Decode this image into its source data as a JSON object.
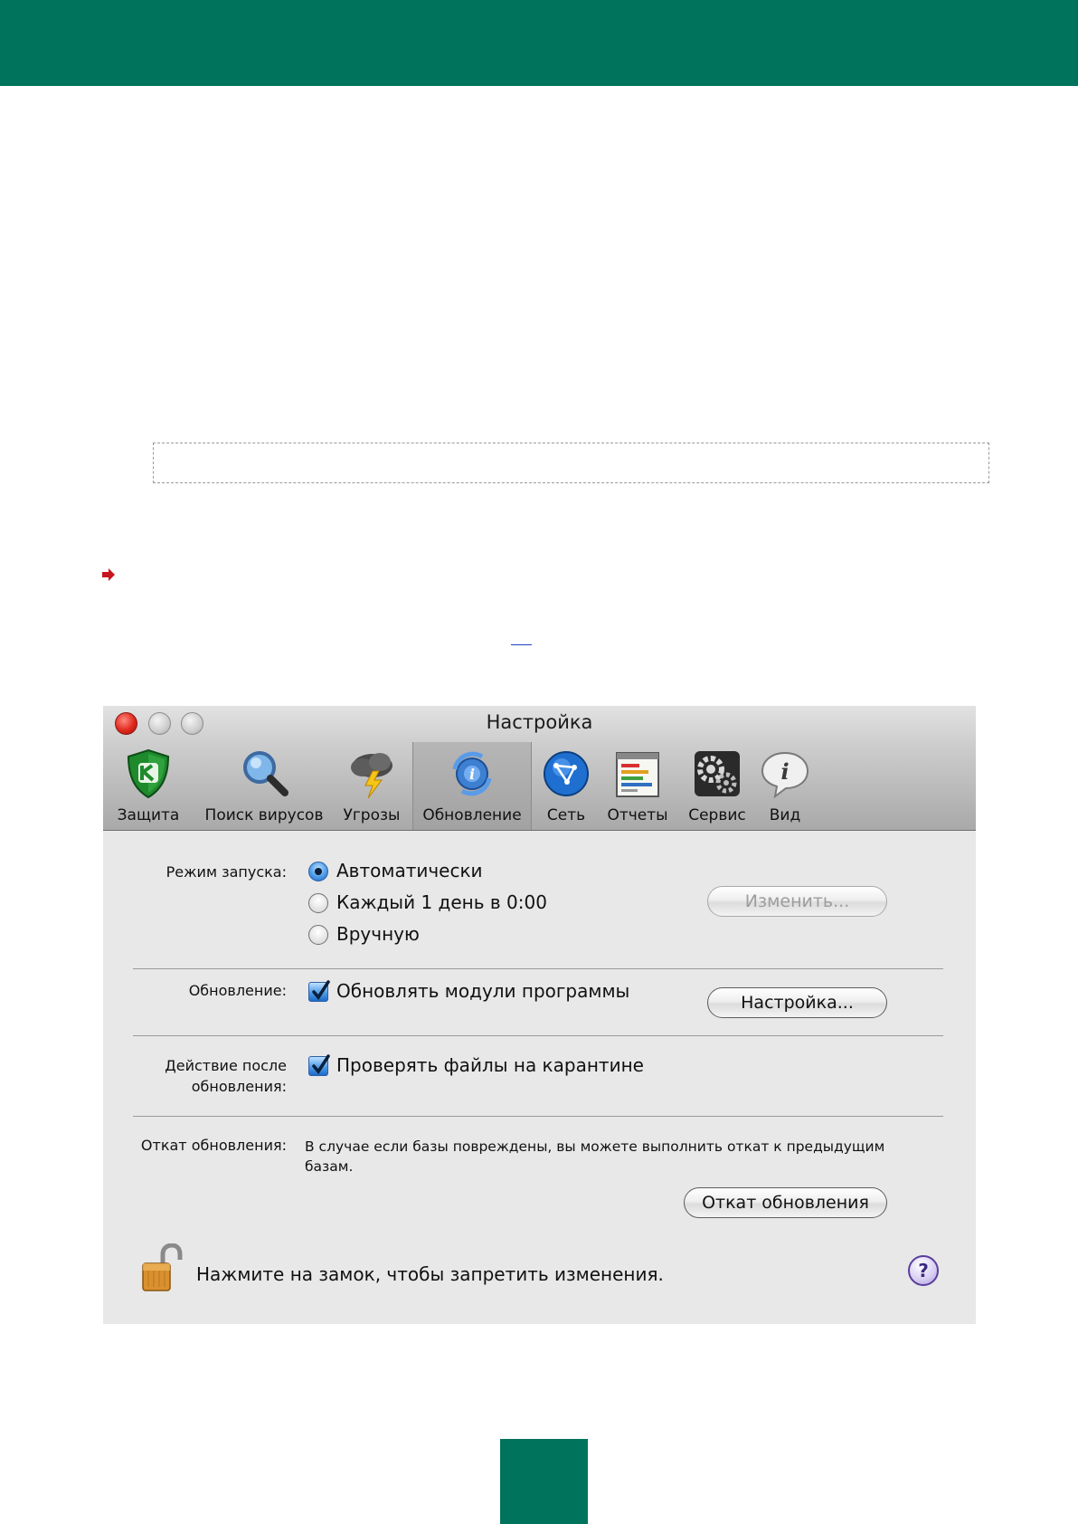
{
  "colors": {
    "brand_green": "#00735c",
    "window_bg": "#e8e8e8"
  },
  "window": {
    "title": "Настройка",
    "toolbar": [
      {
        "label": "Защита",
        "icon": "shield-k-icon"
      },
      {
        "label": "Поиск вирусов",
        "icon": "magnifier-icon"
      },
      {
        "label": "Угрозы",
        "icon": "storm-cloud-icon"
      },
      {
        "label": "Обновление",
        "icon": "update-globe-icon",
        "selected": true
      },
      {
        "label": "Сеть",
        "icon": "network-globe-icon"
      },
      {
        "label": "Отчеты",
        "icon": "report-icon"
      },
      {
        "label": "Сервис",
        "icon": "gears-icon"
      },
      {
        "label": "Вид",
        "icon": "info-bubble-icon"
      }
    ],
    "launch_mode": {
      "label": "Режим запуска:",
      "options": [
        "Автоматически",
        "Каждый 1 день в 0:00",
        "Вручную"
      ],
      "selected": "Автоматически",
      "change_button": "Изменить..."
    },
    "update": {
      "label": "Обновление:",
      "checkbox": "Обновлять модули программы",
      "checked": true,
      "settings_button": "Настройка..."
    },
    "after_update": {
      "label_line1": "Действие после",
      "label_line2": "обновления:",
      "checkbox": "Проверять файлы на карантине",
      "checked": true
    },
    "rollback": {
      "label": "Откат обновления:",
      "description": "В случае если базы повреждены, вы можете выполнить откат к предыдущим базам.",
      "button": "Откат обновления"
    },
    "lock_text": "Нажмите на замок, чтобы запретить изменения.",
    "help": "?"
  }
}
